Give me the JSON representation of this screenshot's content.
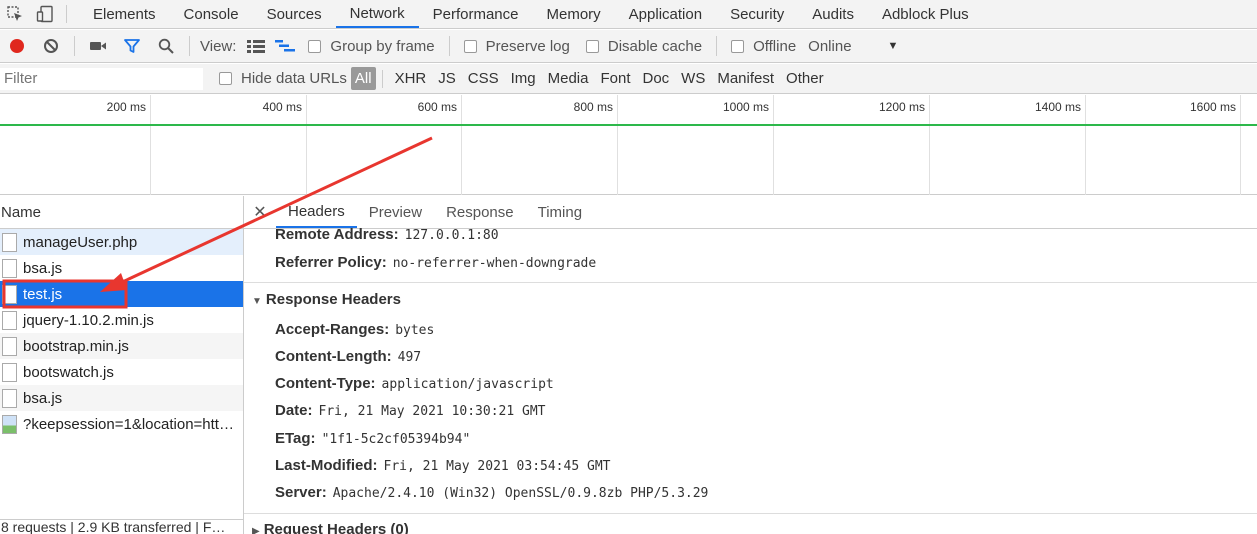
{
  "main_tabs": [
    "Elements",
    "Console",
    "Sources",
    "Network",
    "Performance",
    "Memory",
    "Application",
    "Security",
    "Audits",
    "Adblock Plus"
  ],
  "active_tab": "Network",
  "toolbar": {
    "view_label": "View:",
    "group_by_frame": "Group by frame",
    "preserve_log": "Preserve log",
    "disable_cache": "Disable cache",
    "offline": "Offline",
    "throttle": "Online"
  },
  "filter": {
    "placeholder": "Filter",
    "hide_data_urls": "Hide data URLs",
    "types": [
      "All",
      "XHR",
      "JS",
      "CSS",
      "Img",
      "Media",
      "Font",
      "Doc",
      "WS",
      "Manifest",
      "Other"
    ]
  },
  "overview": {
    "ticks": [
      "200 ms",
      "400 ms",
      "600 ms",
      "800 ms",
      "1000 ms",
      "1200 ms",
      "1400 ms",
      "1600 ms"
    ]
  },
  "requests": {
    "header": "Name",
    "items": [
      "manageUser.php",
      "bsa.js",
      "test.js",
      "jquery-1.10.2.min.js",
      "bootstrap.min.js",
      "bootswatch.js",
      "bsa.js",
      "?keepsession=1&location=htt…"
    ],
    "selected_index": 2
  },
  "status_bar": "8 requests | 2.9 KB transferred | F…",
  "details": {
    "tabs": [
      "Headers",
      "Preview",
      "Response",
      "Timing"
    ],
    "active_tab": "Headers",
    "general": [
      {
        "key": "Remote Address:",
        "value": "127.0.0.1:80"
      },
      {
        "key": "Referrer Policy:",
        "value": "no-referrer-when-downgrade"
      }
    ],
    "response_headers_title": "Response Headers",
    "response_headers": [
      {
        "key": "Accept-Ranges:",
        "value": "bytes"
      },
      {
        "key": "Content-Length:",
        "value": "497"
      },
      {
        "key": "Content-Type:",
        "value": "application/javascript"
      },
      {
        "key": "Date:",
        "value": "Fri, 21 May 2021 10:30:21 GMT"
      },
      {
        "key": "ETag:",
        "value": "\"1f1-5c2cf05394b94\""
      },
      {
        "key": "Last-Modified:",
        "value": "Fri, 21 May 2021 03:54:45 GMT"
      },
      {
        "key": "Server:",
        "value": "Apache/2.4.10 (Win32) OpenSSL/0.9.8zb PHP/5.3.29"
      }
    ],
    "request_headers_title": "Request Headers (0)"
  },
  "colors": {
    "accent": "#1a73e8",
    "record": "#e0281e",
    "timeline_green": "#2db84b",
    "annotation_red": "#e8362f"
  }
}
